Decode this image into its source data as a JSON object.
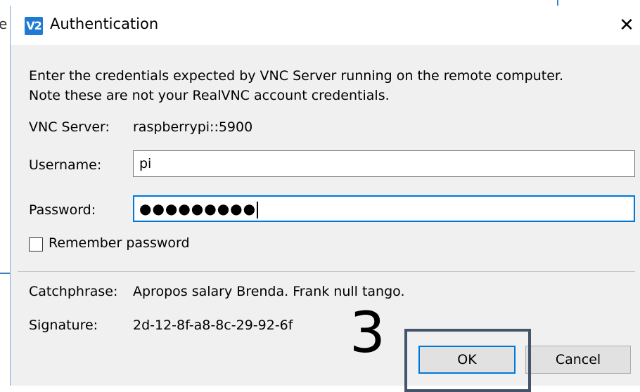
{
  "background": {
    "edge_letter": "e"
  },
  "dialog": {
    "app_icon_text": "V2",
    "title": "Authentication",
    "close_glyph": "✕",
    "intro_line1": "Enter the credentials expected by VNC Server running on the remote computer.",
    "intro_line2": "Note these are not your RealVNC account credentials.",
    "server_label": "VNC Server:",
    "server_value": "raspberrypi::5900",
    "username_label": "Username:",
    "username_value": "pi",
    "password_label": "Password:",
    "password_value": "●●●●●●●●●",
    "remember_label": "Remember password",
    "remember_checked": false,
    "catchphrase_label": "Catchphrase:",
    "catchphrase_value": "Apropos salary Brenda. Frank null tango.",
    "signature_label": "Signature:",
    "signature_value": "2d-12-8f-a8-8c-29-92-6f",
    "ok_label": "OK",
    "cancel_label": "Cancel"
  },
  "annotation": {
    "step_number": "3"
  },
  "colors": {
    "accent": "#0078d7",
    "icon_bg": "#1f7ad1",
    "annotation_border": "#44546a"
  }
}
